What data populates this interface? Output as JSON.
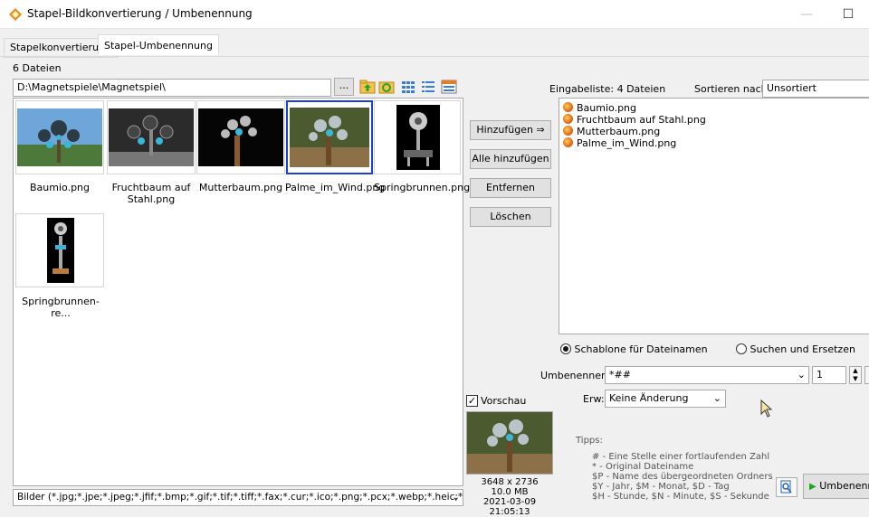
{
  "window": {
    "title": "Stapel-Bildkonvertierung / Umbenennung",
    "minimize": "—",
    "maximize": "☐",
    "close": "✕"
  },
  "tabs": [
    {
      "label": "Stapelkonvertierung"
    },
    {
      "label": "Stapel-Umbenennung"
    }
  ],
  "left": {
    "file_count": "6 Dateien",
    "path": "D:\\Magnetspiele\\Magnetspiel\\",
    "browse_label": "...",
    "thumbnails": [
      {
        "name": "Baumio.png"
      },
      {
        "name": "Fruchtbaum auf Stahl.png"
      },
      {
        "name": "Mutterbaum.png"
      },
      {
        "name": "Palme_im_Wind.png"
      },
      {
        "name": "Springbrunnen.png"
      },
      {
        "name": "Springbrunnen-re..."
      }
    ],
    "filter": "Bilder (*.jpg;*.jpe;*.jpeg;*.jfif;*.bmp;*.gif;*.tif;*.tiff;*.fax;*.cur;*.ico;*.png;*.pcx;*.webp;*.heic;*.he"
  },
  "middle": {
    "add_label": "Hinzufügen ⇒",
    "add_all_label": "Alle hinzufügen",
    "remove_label": "Entfernen",
    "delete_label": "Löschen",
    "preview_label": "Vorschau",
    "preview_checked": "✓",
    "preview_dims": "3648 x 2736",
    "preview_size": "10.0 MB",
    "preview_date": "2021-03-09 21:05:13"
  },
  "right": {
    "input_list_label": "Eingabeliste:",
    "input_list_count": "4 Dateien",
    "sort_label": "Sortieren nach:",
    "sort_value": "Unsortiert",
    "files": [
      {
        "name": "Baumio.png"
      },
      {
        "name": "Fruchtbaum auf Stahl.png"
      },
      {
        "name": "Mutterbaum.png"
      },
      {
        "name": "Palme_im_Wind.png"
      }
    ],
    "radio_template": "Schablone für Dateinamen",
    "radio_search": "Suchen und Ersetzen",
    "rename_label": "Umbenennen in:",
    "rename_value": "*##",
    "start_value": "1",
    "ext_label": "Erw:",
    "ext_value": "Keine Änderung",
    "tips_label": "Tipps:",
    "tips": [
      "#  - Eine Stelle einer fortlaufenden Zahl",
      "*  - Original Dateiname",
      "$P - Name des übergeordneten Ordners",
      "$Y - Jahr,    $M - Monat,    $D - Tag",
      "$H - Stunde,   $N - Minute,   $S - Sekunde"
    ],
    "rename_button": "Umbenenne"
  },
  "colors": {
    "selection": "#1b40d4",
    "window_bg": "#f0f0f0"
  }
}
